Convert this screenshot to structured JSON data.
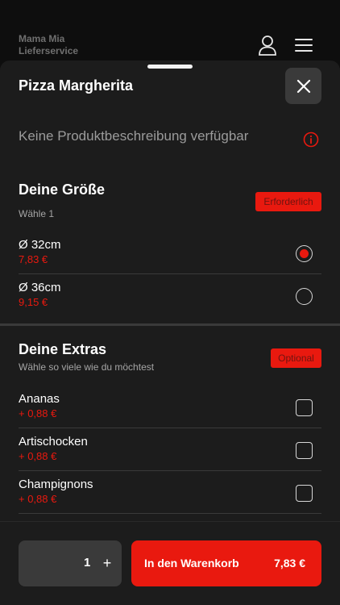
{
  "header": {
    "brand_line1": "Mama Mia",
    "brand_line2": "Lieferservice",
    "user_icon": "user-icon",
    "menu_icon": "hamburger-menu-icon"
  },
  "product": {
    "title": "Pizza Margherita",
    "description": "Keine Produktbeschreibung verfügbar"
  },
  "sizes": {
    "title": "Deine Größe",
    "subtitle": "Wähle 1",
    "badge": "Erforderlich",
    "options": [
      {
        "name": "Ø 32cm",
        "price": "7,83 €",
        "selected": true
      },
      {
        "name": "Ø 36cm",
        "price": "9,15 €",
        "selected": false
      }
    ]
  },
  "extras": {
    "title": "Deine Extras",
    "subtitle": "Wähle so viele wie du möchtest",
    "badge": "Optional",
    "options": [
      {
        "name": "Ananas",
        "price": "+ 0,88 €",
        "checked": false
      },
      {
        "name": "Artischocken",
        "price": "+ 0,88 €",
        "checked": false
      },
      {
        "name": "Champignons",
        "price": "+ 0,88 €",
        "checked": false
      }
    ]
  },
  "footer": {
    "quantity": "1",
    "plus_label": "+",
    "cart_label": "In den Warenkorb",
    "cart_price": "7,83 €"
  },
  "colors": {
    "accent": "#e9190f",
    "background": "#1c1c1c",
    "surface": "#3a3a3a"
  }
}
